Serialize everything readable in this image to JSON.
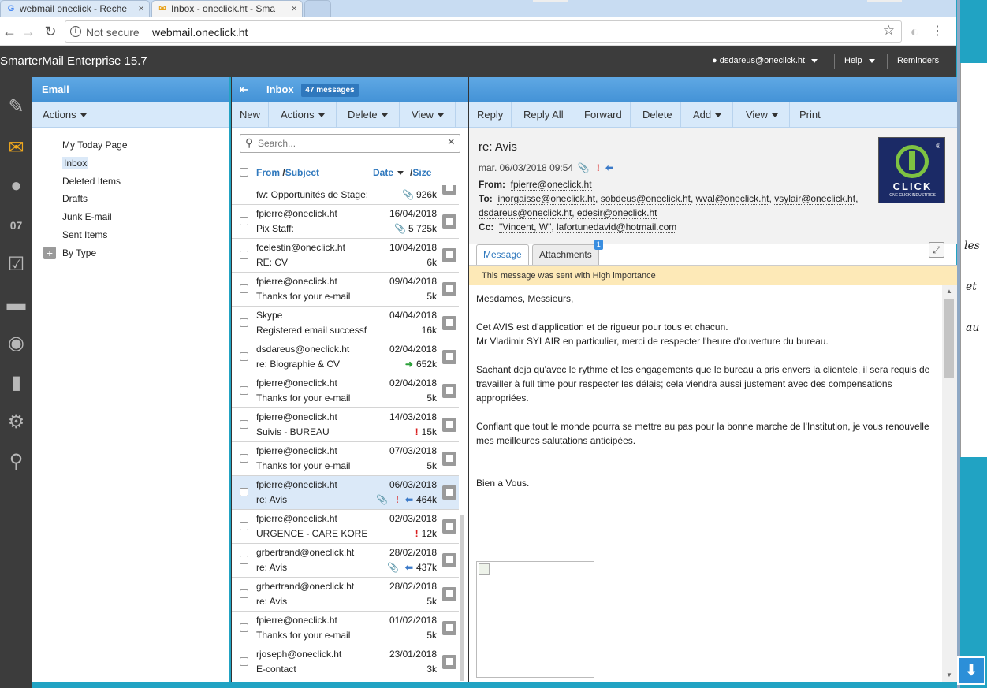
{
  "browser": {
    "tabs": [
      {
        "title": "webmail oneclick - Reche",
        "icon": "G"
      },
      {
        "title": "Inbox - oneclick.ht - Sma",
        "icon": "✉"
      }
    ],
    "security": "Not secure",
    "url": "webmail.oneclick.ht"
  },
  "app": {
    "title": "SmarterMail Enterprise 15.7",
    "user": "dsdareus@oneclick.ht",
    "help": "Help",
    "reminders": "Reminders"
  },
  "folders_panel": {
    "title": "Email",
    "actions": "Actions",
    "items": [
      "My Today Page",
      "Inbox",
      "Deleted Items",
      "Drafts",
      "Junk E-mail",
      "Sent Items",
      "By Type"
    ],
    "selected": "Inbox"
  },
  "list_panel": {
    "title": "Inbox",
    "count_badge": "47 messages",
    "toolbar": {
      "new": "New",
      "actions": "Actions",
      "delete": "Delete",
      "view": "View"
    },
    "search_placeholder": "Search...",
    "columns": {
      "from": "From",
      "subject": "Subject",
      "date": "Date",
      "size": "Size"
    },
    "messages": [
      {
        "from": "",
        "subject": "fw: Opportunités de Stage:",
        "date": "",
        "size": "926k",
        "attach": true
      },
      {
        "from": "fpierre@oneclick.ht",
        "subject": "Pix Staff:",
        "date": "16/04/2018",
        "size": "5 725k",
        "attach": true
      },
      {
        "from": "fcelestin@oneclick.ht",
        "subject": "RE: CV",
        "date": "10/04/2018",
        "size": "6k"
      },
      {
        "from": "fpierre@oneclick.ht",
        "subject": "Thanks for your e-mail",
        "date": "09/04/2018",
        "size": "5k"
      },
      {
        "from": "Skype",
        "subject": "Registered email successf",
        "date": "04/04/2018",
        "size": "16k"
      },
      {
        "from": "dsdareus@oneclick.ht",
        "subject": "re: Biographie & CV",
        "date": "02/04/2018",
        "size": "652k",
        "forwarded": true
      },
      {
        "from": "fpierre@oneclick.ht",
        "subject": "Thanks for your e-mail",
        "date": "02/04/2018",
        "size": "5k"
      },
      {
        "from": "fpierre@oneclick.ht",
        "subject": "Suivis - BUREAU",
        "date": "14/03/2018",
        "size": "15k",
        "important": true
      },
      {
        "from": "fpierre@oneclick.ht",
        "subject": "Thanks for your e-mail",
        "date": "07/03/2018",
        "size": "5k"
      },
      {
        "from": "fpierre@oneclick.ht",
        "subject": "re: Avis",
        "date": "06/03/2018",
        "size": "464k",
        "attach": true,
        "important": true,
        "replied": true,
        "selected": true
      },
      {
        "from": "fpierre@oneclick.ht",
        "subject": "URGENCE - CARE KORE",
        "date": "02/03/2018",
        "size": "12k",
        "important": true
      },
      {
        "from": "grbertrand@oneclick.ht",
        "subject": "re: Avis",
        "date": "28/02/2018",
        "size": "437k",
        "attach": true,
        "replied": true
      },
      {
        "from": "grbertrand@oneclick.ht",
        "subject": "re: Avis",
        "date": "28/02/2018",
        "size": "5k"
      },
      {
        "from": "fpierre@oneclick.ht",
        "subject": "Thanks for your e-mail",
        "date": "01/02/2018",
        "size": "5k"
      },
      {
        "from": "rjoseph@oneclick.ht",
        "subject": "E-contact",
        "date": "23/01/2018",
        "size": "3k"
      }
    ]
  },
  "reader": {
    "toolbar": {
      "reply": "Reply",
      "reply_all": "Reply All",
      "forward": "Forward",
      "delete": "Delete",
      "add": "Add",
      "view": "View",
      "print": "Print"
    },
    "subject": "re: Avis",
    "date": "mar. 06/03/2018 09:54",
    "from_label": "From",
    "from": "fpierre@oneclick.ht",
    "to_label": "To",
    "to_line1": [
      "inorgaisse@oneclick.ht",
      "sobdeus@oneclick.ht",
      "wval@oneclick.ht",
      "vsylair@oneclick.ht"
    ],
    "to_line2": [
      "dsdareus@oneclick.ht",
      "edesir@oneclick.ht"
    ],
    "cc_label": "Cc",
    "cc": [
      "\"Vincent, W\"",
      "lafortunedavid@hotmail.com"
    ],
    "logo_text": "CLICK",
    "logo_sub": "ONE CLICK INDUSTRIES",
    "tabs": {
      "message": "Message",
      "attachments": "Attachments",
      "attachments_count": "1"
    },
    "importance_banner": "This message was sent with High importance",
    "body": [
      "Mesdames, Messieurs,",
      "Cet AVIS est d'application et de rigueur pour tous et chacun.",
      "Mr Vladimir SYLAIR en particulier, merci de respecter l'heure d'ouverture du bureau.",
      "Sachant deja qu'avec le rythme et les engagements que le bureau a pris envers la clientele, il sera requis de travailler à full time pour respecter les délais; cela viendra aussi justement avec des compensations appropriées.",
      "Confiant que tout le monde pourra se mettre au pas pour la bonne marche de l'Institution, je vous renouvelle mes meilleures salutations anticipées.",
      "Bien a Vous."
    ]
  },
  "background_window": {
    "fragments": [
      "les",
      "et",
      "au"
    ]
  },
  "colors": {
    "accent": "#4392d6",
    "header": "#3c3c3c",
    "toolbar": "#d7e9fa",
    "important": "#d81e1e",
    "banner": "#fde9b7"
  }
}
